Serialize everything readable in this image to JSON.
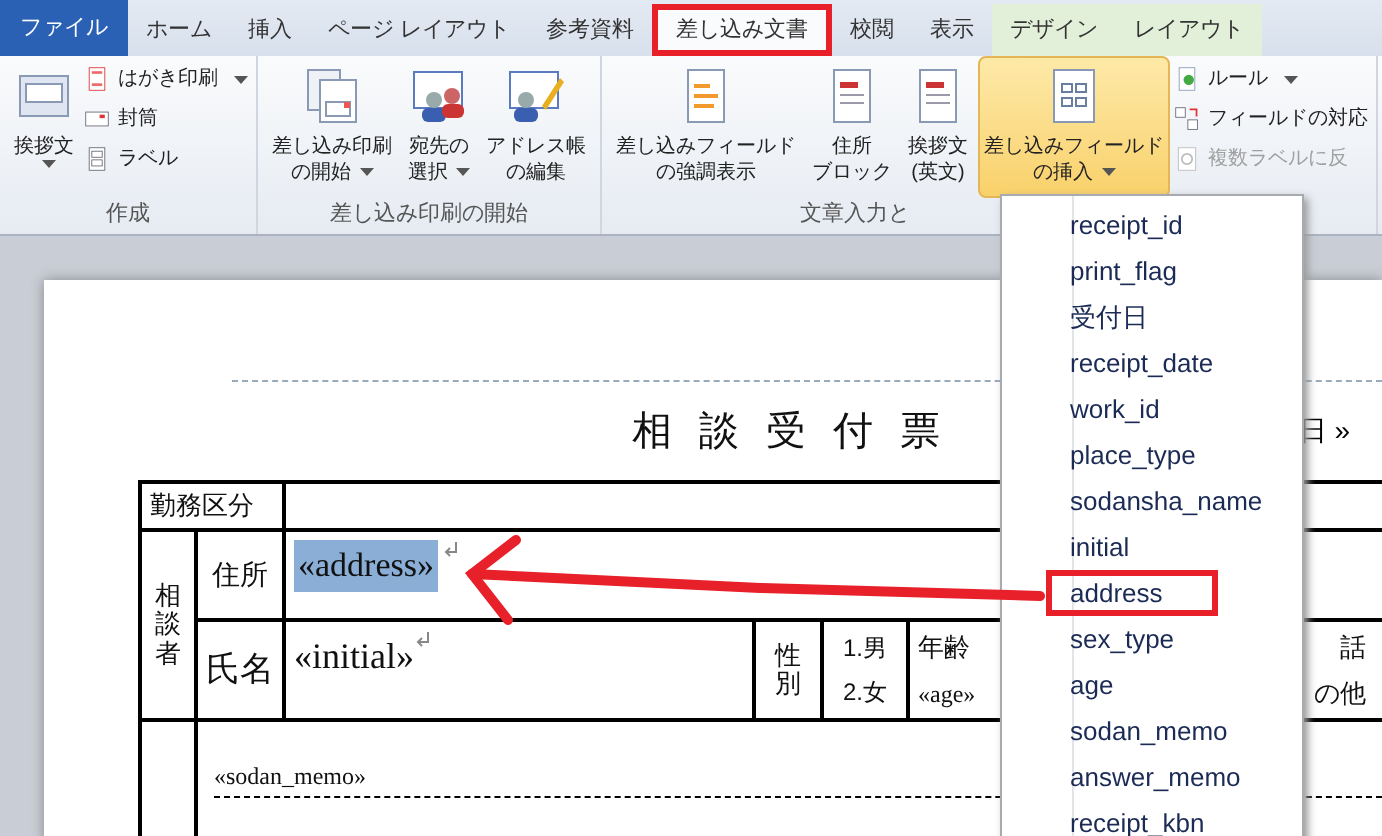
{
  "tabs": [
    {
      "label": "ファイル",
      "kind": "file",
      "selected": false,
      "annotated": false
    },
    {
      "label": "ホーム",
      "kind": "main",
      "selected": false,
      "annotated": false
    },
    {
      "label": "挿入",
      "kind": "main",
      "selected": false,
      "annotated": false
    },
    {
      "label": "ページ レイアウト",
      "kind": "main",
      "selected": false,
      "annotated": false
    },
    {
      "label": "参考資料",
      "kind": "main",
      "selected": false,
      "annotated": false
    },
    {
      "label": "差し込み文書",
      "kind": "main",
      "selected": true,
      "annotated": true
    },
    {
      "label": "校閲",
      "kind": "main",
      "selected": false,
      "annotated": false
    },
    {
      "label": "表示",
      "kind": "main",
      "selected": false,
      "annotated": false
    },
    {
      "label": "デザイン",
      "kind": "context",
      "selected": false,
      "annotated": false
    },
    {
      "label": "レイアウト",
      "kind": "context",
      "selected": false,
      "annotated": false
    }
  ],
  "ribbon": {
    "groups": [
      {
        "label": "作成",
        "items": [
          {
            "kind": "large",
            "lines": [
              "挨拶文"
            ],
            "dropdown": true,
            "selected": false
          },
          {
            "kind": "stack",
            "items": [
              {
                "label": "はがき印刷",
                "dropdown": true,
                "disabled": false
              },
              {
                "label": "封筒",
                "dropdown": false,
                "disabled": false
              },
              {
                "label": "ラベル",
                "dropdown": false,
                "disabled": false
              }
            ]
          }
        ]
      },
      {
        "label": "差し込み印刷の開始",
        "items": [
          {
            "kind": "large",
            "lines": [
              "差し込み印刷",
              "の開始"
            ],
            "dropdown": true,
            "selected": false
          },
          {
            "kind": "large",
            "lines": [
              "宛先の",
              "選択"
            ],
            "dropdown": true,
            "selected": false
          },
          {
            "kind": "large",
            "lines": [
              "アドレス帳",
              "の編集"
            ],
            "dropdown": false,
            "selected": false
          }
        ]
      },
      {
        "label": "文章入力と",
        "items": [
          {
            "kind": "large",
            "lines": [
              "差し込みフィールド",
              "の強調表示"
            ],
            "dropdown": false,
            "selected": false
          },
          {
            "kind": "large",
            "lines": [
              "住所",
              "ブロック"
            ],
            "dropdown": false,
            "selected": false
          },
          {
            "kind": "large",
            "lines": [
              "挨拶文",
              "(英文)"
            ],
            "dropdown": false,
            "selected": false
          },
          {
            "kind": "large",
            "lines": [
              "差し込みフィールド",
              "の挿入"
            ],
            "dropdown": true,
            "selected": true
          },
          {
            "kind": "stack",
            "items": [
              {
                "label": "ルール",
                "dropdown": true,
                "disabled": false
              },
              {
                "label": "フィールドの対応",
                "dropdown": false,
                "disabled": false
              },
              {
                "label": "複数ラベルに反",
                "dropdown": false,
                "disabled": true
              }
            ]
          }
        ]
      }
    ]
  },
  "document": {
    "title": "相 談 受 付 票",
    "header_fragment": "日 »",
    "work_type_label": "勤務区分",
    "consultant_label": "相談者",
    "address_label": "住所",
    "address_field": {
      "text": "«address»",
      "selected": true
    },
    "name_label": "氏名",
    "name_field": "«initial»",
    "sex_label": "性別",
    "sex_options": [
      "1.男",
      "2.女"
    ],
    "age_label": "年齢",
    "age_field": "«age»",
    "column_fragments": [
      "話",
      "の他"
    ],
    "memo_field": "«sodan_memo»"
  },
  "field_menu": {
    "items": [
      {
        "label": "receipt_id",
        "annotated": false
      },
      {
        "label": "print_flag",
        "annotated": false
      },
      {
        "label": "受付日",
        "annotated": false
      },
      {
        "label": "receipt_date",
        "annotated": false
      },
      {
        "label": "work_id",
        "annotated": false
      },
      {
        "label": "place_type",
        "annotated": false
      },
      {
        "label": "sodansha_name",
        "annotated": false
      },
      {
        "label": "initial",
        "annotated": false
      },
      {
        "label": "address",
        "annotated": true
      },
      {
        "label": "sex_type",
        "annotated": false
      },
      {
        "label": "age",
        "annotated": false
      },
      {
        "label": "sodan_memo",
        "annotated": false
      },
      {
        "label": "answer_memo",
        "annotated": false
      },
      {
        "label": "receipt_kbn",
        "annotated": false
      }
    ]
  },
  "annotation_arrow": true
}
